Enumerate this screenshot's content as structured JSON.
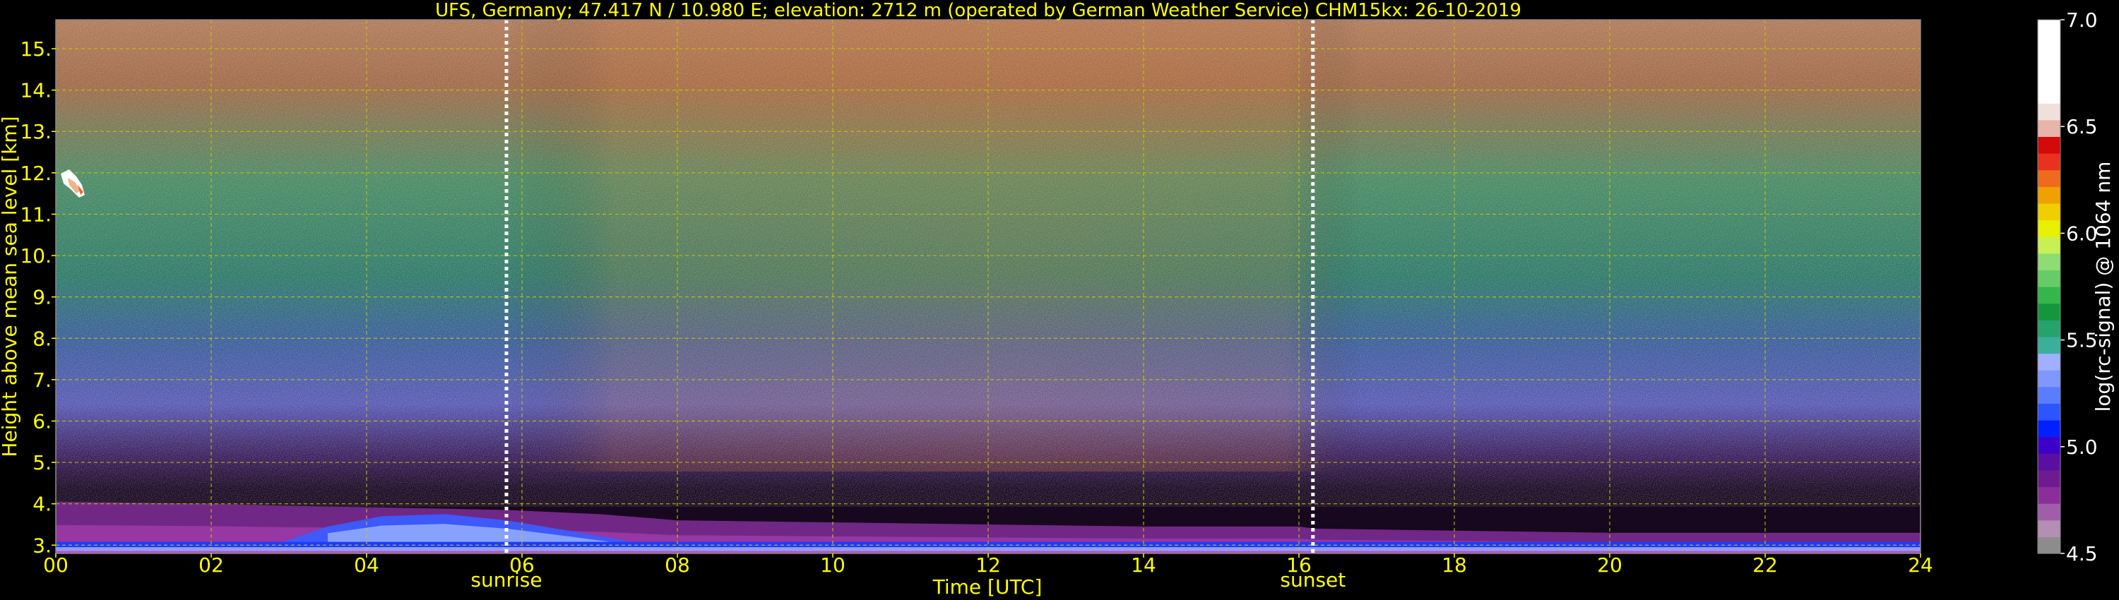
{
  "chart_data": {
    "type": "heatmap",
    "title": "UFS, Germany; 47.417 N / 10.980 E; elevation: 2712 m  (operated by German Weather Service)    CHM15kx: 26-10-2019",
    "xlabel": "Time [UTC]",
    "ylabel": "Height above mean sea level [km]",
    "colorbar_label": "log(rc-signal) @ 1064 nm",
    "xlim": [
      0,
      24
    ],
    "ylim": [
      2.8,
      15.7
    ],
    "x_ticks": [
      "00",
      "02",
      "04",
      "06",
      "08",
      "10",
      "12",
      "14",
      "16",
      "18",
      "20",
      "22",
      "24"
    ],
    "x_tick_values": [
      0,
      2,
      4,
      6,
      8,
      10,
      12,
      14,
      16,
      18,
      20,
      22,
      24
    ],
    "y_ticks": [
      "3.",
      "4.",
      "5.",
      "6.",
      "7.",
      "8.",
      "9.",
      "10.",
      "11.",
      "12.",
      "13.",
      "14.",
      "15."
    ],
    "y_tick_values": [
      3,
      4,
      5,
      6,
      7,
      8,
      9,
      10,
      11,
      12,
      13,
      14,
      15
    ],
    "colorbar_range": [
      4.5,
      7.0
    ],
    "colorbar_ticks": [
      "4.5",
      "5.0",
      "5.5",
      "6.0",
      "6.5",
      "7.0"
    ],
    "colorbar_tick_values": [
      4.5,
      5.0,
      5.5,
      6.0,
      6.5,
      7.0
    ],
    "colorbar_colors": [
      "#8c8c8c",
      "#b38fb3",
      "#9e5ea8",
      "#8a2f9a",
      "#6e1b8f",
      "#5a0fa0",
      "#3c00c8",
      "#0020ff",
      "#2d55ff",
      "#5a7cff",
      "#7f98ff",
      "#a0b0ff",
      "#3ab09a",
      "#26a26c",
      "#14963c",
      "#34b64a",
      "#66cc66",
      "#90dc74",
      "#c8f054",
      "#e6f000",
      "#f0cf00",
      "#f0a000",
      "#f06a1e",
      "#e6321e",
      "#d20a0a",
      "#e6b4a8",
      "#f0e0dc",
      "#ffffff",
      "#ffffff",
      "#ffffff",
      "#ffffff",
      "#ffffff"
    ],
    "grid": true,
    "grid_color": "#c8c800",
    "text_color": "#ffff00",
    "markers": [
      {
        "label": "sunrise",
        "x": 5.8
      },
      {
        "label": "sunset",
        "x": 16.18
      }
    ],
    "boundary_layer_top_km": [
      [
        0,
        4.05
      ],
      [
        2,
        4.0
      ],
      [
        3,
        3.95
      ],
      [
        4.5,
        3.9
      ],
      [
        5.8,
        3.85
      ],
      [
        7,
        3.75
      ],
      [
        8,
        3.6
      ],
      [
        10,
        3.55
      ],
      [
        12,
        3.5
      ],
      [
        14,
        3.45
      ],
      [
        16,
        3.45
      ],
      [
        16.2,
        3.4
      ],
      [
        18,
        3.35
      ],
      [
        20,
        3.3
      ],
      [
        22,
        3.3
      ],
      [
        24,
        3.3
      ]
    ],
    "aerosol_plume_top_km": [
      [
        2.8,
        3.0
      ],
      [
        3.5,
        3.45
      ],
      [
        4.2,
        3.7
      ],
      [
        5.0,
        3.75
      ],
      [
        5.8,
        3.6
      ],
      [
        6.6,
        3.35
      ],
      [
        7.5,
        3.05
      ],
      [
        8.5,
        2.95
      ]
    ]
  }
}
